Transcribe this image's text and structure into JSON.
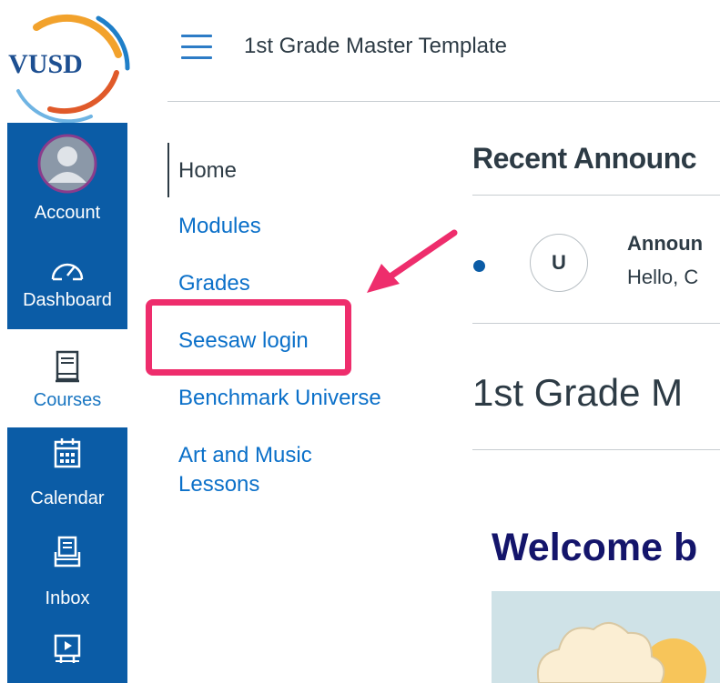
{
  "logo": {
    "text": "VUSD"
  },
  "global_nav": {
    "account": "Account",
    "dashboard": "Dashboard",
    "courses": "Courses",
    "calendar": "Calendar",
    "inbox": "Inbox"
  },
  "header": {
    "course_title": "1st Grade Master Template"
  },
  "course_nav": {
    "items": [
      "Home",
      "Modules",
      "Grades",
      "Seesaw login",
      "Benchmark Universe",
      "Art and Music",
      "Lessons"
    ]
  },
  "main": {
    "recent_title": "Recent Announc",
    "announcement": {
      "avatar": "U",
      "title": "Announ",
      "body": "Hello, C"
    },
    "page_title": "1st Grade M",
    "welcome": "Welcome b"
  },
  "colors": {
    "nav_blue": "#0b5ca6",
    "link_blue": "#0b70c9",
    "highlight_pink": "#ee2d6c",
    "welcome_navy": "#14156b"
  }
}
